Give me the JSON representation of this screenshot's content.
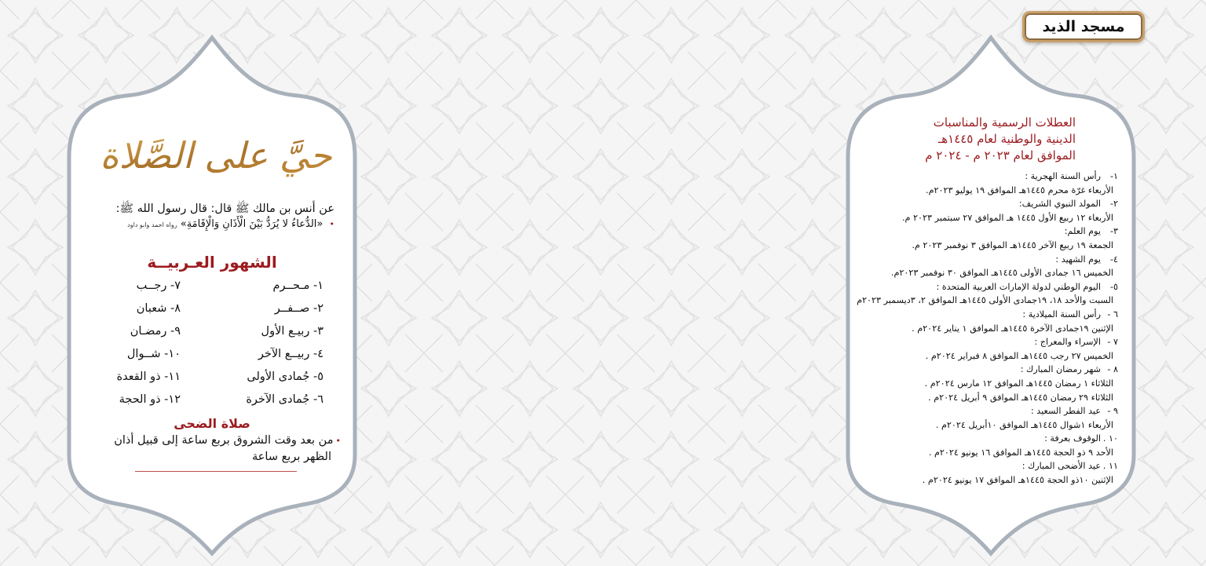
{
  "colors": {
    "accent_red": "#9b1b1f",
    "gold": "#b07a30",
    "frame_gray": "#a9b1bb",
    "text": "#111111"
  },
  "right_page": {
    "badge": {
      "label": "مسجد الذيد"
    },
    "title_lines": [
      "العطلات الرسمية والمناسبات",
      "الدينية والوطنية لعام ١٤٤٥هـ",
      "الموافق لعام ٢٠٢٣ م - ٢٠٢٤ م"
    ],
    "holidays": [
      {
        "num": "١-",
        "head": "رأس السنة الهجرية :",
        "lines": [
          "الأربعاء غرّة محرم ١٤٤٥هـ الموافق ١٩ يوليو ٢٠٢٣م."
        ]
      },
      {
        "num": "٢-",
        "head": "المولد النبوي الشريف:",
        "lines": [
          "الأربعاء ١٢ ربيع الأول ١٤٤٥ هـ الموافق ٢٧ سبتمبر ٢٠٢٣ م."
        ]
      },
      {
        "num": "٣-",
        "head": "يوم العلم:",
        "lines": [
          "الجمعة ١٩ ربيع الآخر ١٤٤٥هـ الموافق ٣ نوفمبر ٢٠٢٣ م."
        ]
      },
      {
        "num": "٤-",
        "head": "يوم الشهيد :",
        "lines": [
          "الخميس ١٦ جمادى الأولى ١٤٤٥هـ الموافق ٣٠ نوفمبر ٢٠٢٣م."
        ]
      },
      {
        "num": "٥-",
        "head": "اليوم الوطني لدولة الإمارات العربية المتحدة :",
        "lines": [
          "السبت والأحد ١٨، ١٩جمادى الأولى ١٤٤٥هـ الموافق ٢، ٣ديسمبر ٢٠٢٣م"
        ]
      },
      {
        "num": "٦ -",
        "head": "رأس السنة الميلادية :",
        "lines": [
          "الإثنين ١٩جمادى الآخرة ١٤٤٥هـ الموافق ١ يناير ٢٠٢٤م ."
        ]
      },
      {
        "num": "٧ -",
        "head": "الإسراء والمعراج :",
        "lines": [
          "الخميس ٢٧ رجب ١٤٤٥هـ الموافق ٨ فبراير ٢٠٢٤م ."
        ]
      },
      {
        "num": "٨ -",
        "head": "شهر رمضان المبارك :",
        "lines": [
          "الثلاثاء ١ رمضان ١٤٤٥هـ الموافق ١٢ مارس ٢٠٢٤م .",
          "الثلاثاء ٢٩ رمضان ١٤٤٥هـ الموافق ٩ أبريل ٢٠٢٤م ."
        ]
      },
      {
        "num": "٩ -",
        "head": "عيد الفطر السعيد :",
        "lines": [
          "الأربعاء ١شوال ١٤٤٥هـ الموافق ١٠أبريل ٢٠٢٤م ."
        ]
      },
      {
        "num": "١٠ .",
        "head": "الوقوف بعرفة :",
        "lines": [
          "الأحد ٩ ذو الحجة ١٤٤٥هـ الموافق ١٦ يونيو ٢٠٢٤م ."
        ]
      },
      {
        "num": "١١ .",
        "head": "عيد الأضحى المبارك :",
        "lines": [
          "الإثنين ١٠ذو الحجة ١٤٤٥هـ الموافق ١٧ يونيو ٢٠٢٤م ."
        ]
      }
    ]
  },
  "left_page": {
    "calligraphy": "حيَّ على الصَّلاة",
    "hadith": {
      "line1": "عن أنس بن مالك ﷺ قال: قال رسول الله ﷺ:",
      "star": "•",
      "line2": "«الدُّعاءُ لا يُرَدُّ بَيْنَ الْأَذَانِ وَالْإِقَامَةِ»",
      "source": "رواه احمد وابو داود"
    },
    "months_title": "الشهور العـربيــة",
    "months": [
      {
        "label": "١- مـحــرم"
      },
      {
        "label": "٢- صــفــر"
      },
      {
        "label": "٣- ربيـع الأول"
      },
      {
        "label": "٤- ربيــع الآخر"
      },
      {
        "label": "٥- جُمادى الأولى"
      },
      {
        "label": "٦- جُمادى الآخرة"
      },
      {
        "label": "٧- رجــب"
      },
      {
        "label": "٨- شعبان"
      },
      {
        "label": "٩- رمضـان"
      },
      {
        "label": "١٠- شــوال"
      },
      {
        "label": "١١- ذو القعدة"
      },
      {
        "label": "١٢- ذو الحجة"
      }
    ],
    "duha": {
      "title": "صلاة الضحى",
      "star": "•",
      "line1": "من بعد وقت الشروق بربع ساعة إلى قبيل أذان",
      "line2": "الظهر بربع ساعة"
    }
  }
}
